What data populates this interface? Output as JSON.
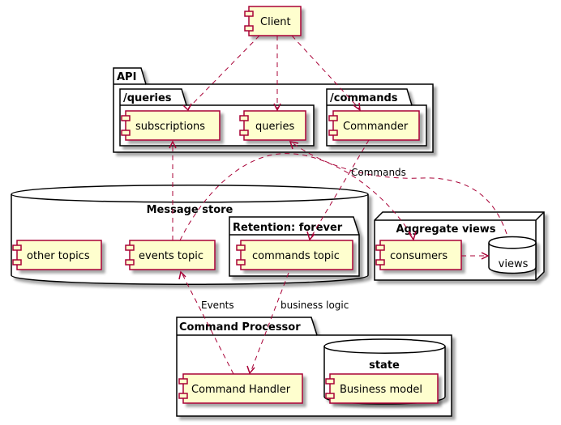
{
  "diagram": {
    "type": "PlantUML component diagram",
    "colors": {
      "component_fill": "#FEFECE",
      "component_border": "#A80036",
      "edge": "#A80036",
      "frame": "#000000"
    },
    "nodes": {
      "client": "Client",
      "subscriptions": "subscriptions",
      "queries": "queries",
      "commander": "Commander",
      "other_topics": "other topics",
      "events_topic": "events topic",
      "commands_topic": "commands topic",
      "consumers": "consumers",
      "views": "views",
      "command_handler": "Command Handler",
      "business_model": "Business model"
    },
    "containers": {
      "api": "API",
      "queries_pkg": "/queries",
      "commands_pkg": "/commands",
      "message_store": "Message store",
      "retention": "Retention: forever",
      "aggregate_views": "Aggregate views",
      "command_processor": "Command Processor",
      "state": "state"
    },
    "edge_labels": {
      "commands": "Commands",
      "events": "Events",
      "business_logic": "business logic"
    },
    "edges": [
      {
        "from": "Client",
        "to": "subscriptions"
      },
      {
        "from": "Client",
        "to": "queries"
      },
      {
        "from": "Client",
        "to": "Commander"
      },
      {
        "from": "Commander",
        "to": "commands topic",
        "label": "Commands"
      },
      {
        "from": "events topic",
        "to": "subscriptions"
      },
      {
        "from": "events topic",
        "to": "consumers"
      },
      {
        "from": "views",
        "to": "queries"
      },
      {
        "from": "consumers",
        "to": "views"
      },
      {
        "from": "commands topic",
        "to": "Command Handler",
        "label": "business logic"
      },
      {
        "from": "Command Handler",
        "to": "events topic",
        "label": "Events"
      }
    ]
  }
}
